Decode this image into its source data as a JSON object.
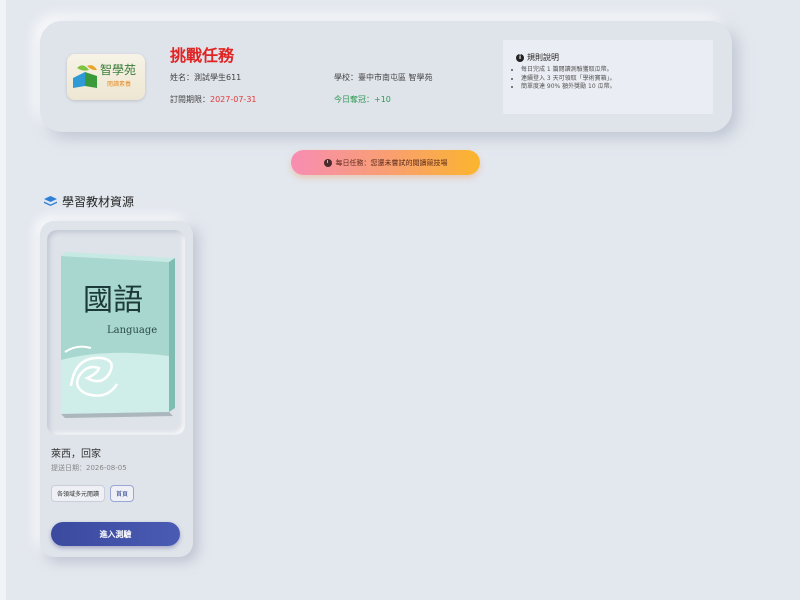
{
  "header": {
    "logo": {
      "title": "智學苑",
      "subtitle": "閱讀素養"
    },
    "title": "挑戰任務",
    "student": {
      "label": "姓名：",
      "value": "測試學生611"
    },
    "school": {
      "label": "學校：",
      "value": "臺中市南屯區 智學苑"
    },
    "subscription": {
      "label": "訂閱期限：",
      "value": "2027-07-31"
    },
    "today_points": {
      "label": "今日奪冠：",
      "value": "+10"
    },
    "rules": {
      "title": "規則說明",
      "items": [
        "每日完成 1 篇閱讀測驗獲取瓜幣。",
        "連續登入 3 天可領取「學術寶箱」。",
        "簡單度達 90% 額外獎勵 10 瓜幣。"
      ]
    }
  },
  "task": {
    "text": "每日任務：您還未嘗試的閱讀競技場"
  },
  "section": {
    "title": "學習教材資源"
  },
  "books": [
    {
      "cover_title": "國語",
      "cover_subtitle": "Language",
      "title": "萊西，回家",
      "date": "提送日期：2026-08-05",
      "tags": [
        "各領域多元閱讀",
        "首頁"
      ],
      "button": "進入測驗"
    }
  ],
  "colors": {
    "accent": "#3b4a9e",
    "title_red": "#e02424",
    "green": "#2e9a52"
  }
}
